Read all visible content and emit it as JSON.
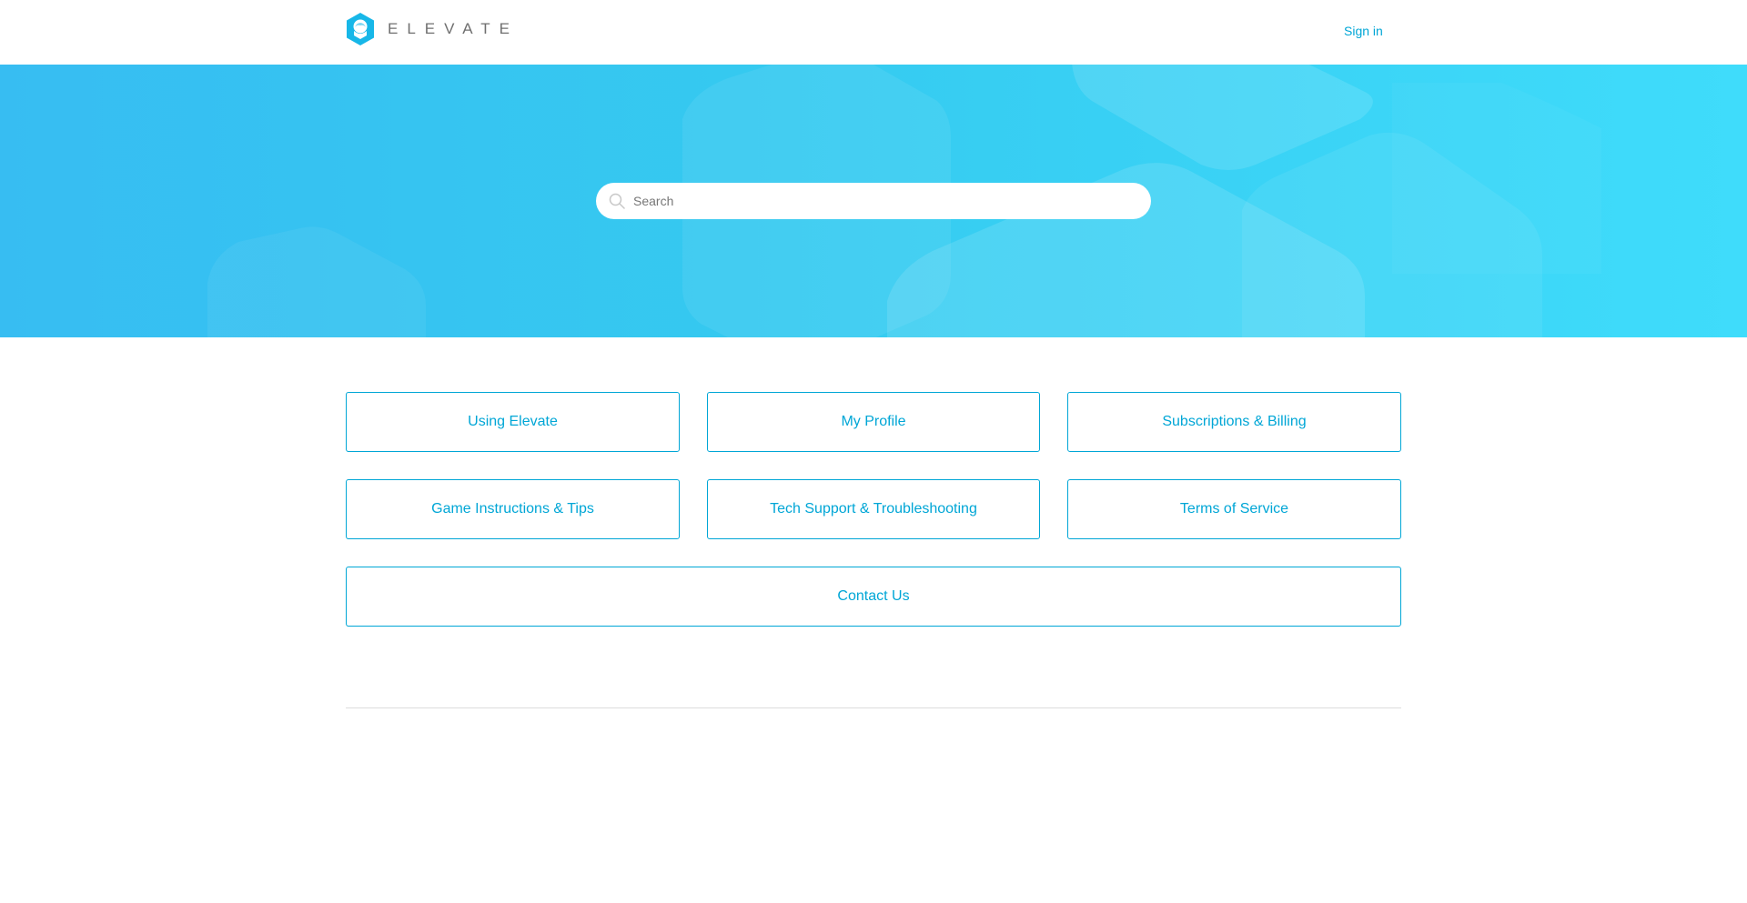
{
  "header": {
    "brand": "ELEVATE",
    "signin_label": "Sign in"
  },
  "icons": {
    "logo": "hexagon-brain-logo-icon",
    "search": "search-icon"
  },
  "search": {
    "placeholder": "Search",
    "value": ""
  },
  "categories": [
    {
      "label": "Using Elevate"
    },
    {
      "label": "My Profile"
    },
    {
      "label": "Subscriptions & Billing"
    },
    {
      "label": "Game Instructions & Tips"
    },
    {
      "label": "Tech Support & Troubleshooting"
    },
    {
      "label": "Terms of Service"
    },
    {
      "label": "Contact Us"
    }
  ],
  "colors": {
    "accent": "#00a6d6",
    "hero_start": "#37bdf2",
    "hero_end": "#3fdcfb"
  }
}
